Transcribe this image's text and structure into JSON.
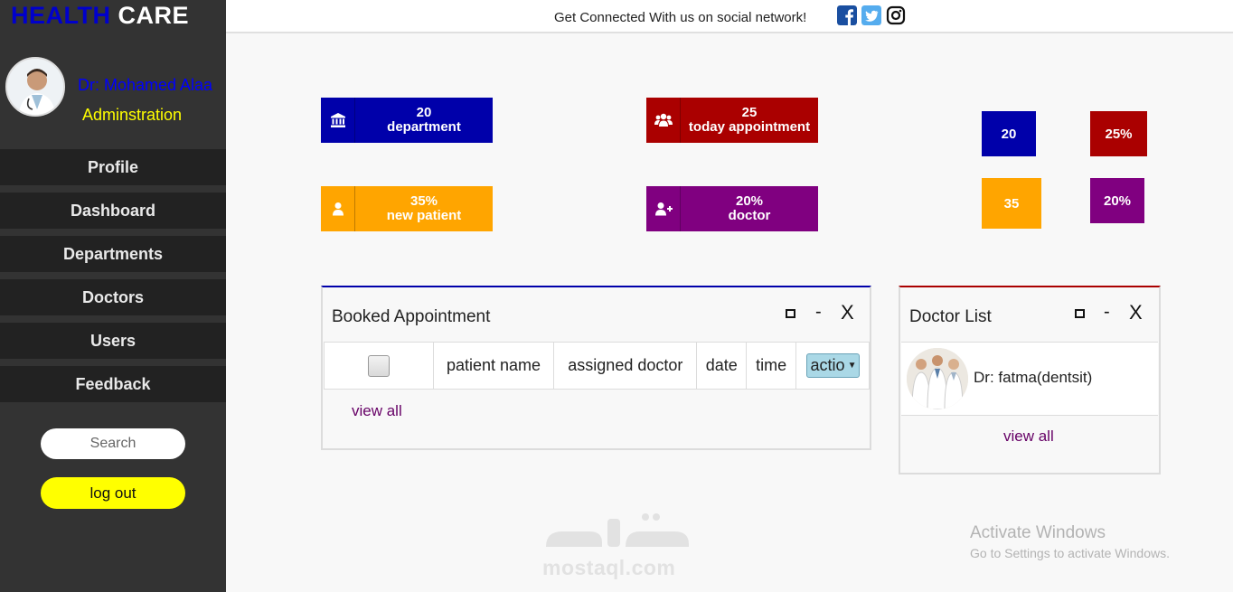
{
  "brand": {
    "part1": "HEALTH",
    "part2": "CARE"
  },
  "profile": {
    "name": "Dr: Mohamed Alaa",
    "role": "Adminstration"
  },
  "nav": [
    "Profile",
    "Dashboard",
    "Departments",
    "Doctors",
    "Users",
    "Feedback"
  ],
  "search": {
    "placeholder": "Search"
  },
  "logout_label": "log out",
  "topbar": {
    "connect_text": "Get Connected With us on social network!"
  },
  "social_icons": [
    "facebook-icon",
    "twitter-icon",
    "instagram-icon"
  ],
  "stats": [
    {
      "value": "20",
      "label": "department",
      "icon": "bank-icon",
      "color": "#0000aa"
    },
    {
      "value": "25",
      "label": "today appointment",
      "icon": "users-group-icon",
      "color": "#aa0000"
    },
    {
      "value": "35%",
      "label": "new patient",
      "icon": "user-icon",
      "color": "#ffa500"
    },
    {
      "value": "20%",
      "label": "doctor",
      "icon": "user-plus-icon",
      "color": "#800080"
    }
  ],
  "mini_stats": [
    "20",
    "25%",
    "35",
    "20%"
  ],
  "booked": {
    "title": "Booked Appointment",
    "controls": {
      "minimize": "-",
      "close": "X"
    },
    "columns": [
      "patient name",
      "assigned doctor",
      "date",
      "time"
    ],
    "action_select": "actio",
    "view_all": "view all"
  },
  "doctor_list": {
    "title": "Doctor List",
    "controls": {
      "minimize": "-",
      "close": "X"
    },
    "doctor": "Dr: fatma(dentsit)",
    "view_all": "view all"
  },
  "watermark": {
    "activate": "Activate Windows",
    "settings": "Go to Settings to activate Windows.",
    "mostaql": "mostaql.com"
  }
}
